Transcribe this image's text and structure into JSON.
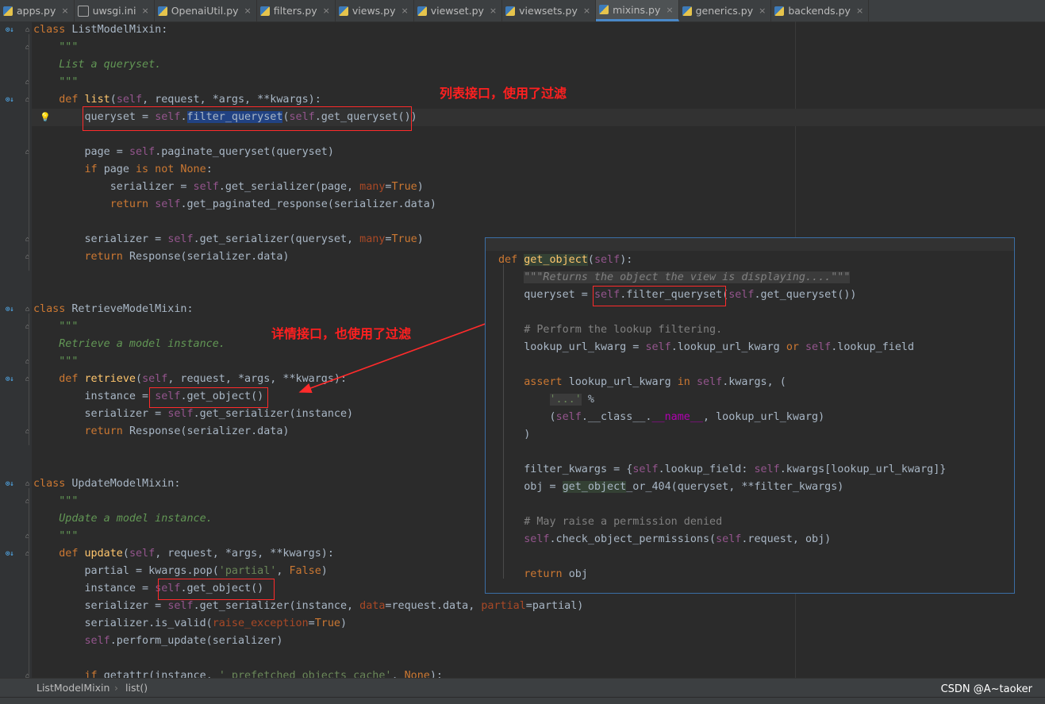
{
  "tabs": [
    {
      "label": "apps.py",
      "type": "py",
      "active": false
    },
    {
      "label": "uwsgi.ini",
      "type": "ini",
      "active": false
    },
    {
      "label": "OpenaiUtil.py",
      "type": "py",
      "active": false
    },
    {
      "label": "filters.py",
      "type": "py",
      "active": false
    },
    {
      "label": "views.py",
      "type": "py",
      "active": false
    },
    {
      "label": "viewset.py",
      "type": "py",
      "active": false
    },
    {
      "label": "viewsets.py",
      "type": "py",
      "active": false
    },
    {
      "label": "mixins.py",
      "type": "py",
      "active": true
    },
    {
      "label": "generics.py",
      "type": "py",
      "active": false
    },
    {
      "label": "backends.py",
      "type": "py",
      "active": false
    }
  ],
  "annotations": {
    "list_note": "列表接口，使用了过滤",
    "detail_note": "详情接口，也使用了过滤"
  },
  "breadcrumb": [
    "ListModelMixin",
    "list()"
  ],
  "watermark": "CSDN @A~taoker",
  "colors": {
    "annotation": "#ff2020",
    "popup_border": "#3b6ea5",
    "selection": "#214283"
  }
}
